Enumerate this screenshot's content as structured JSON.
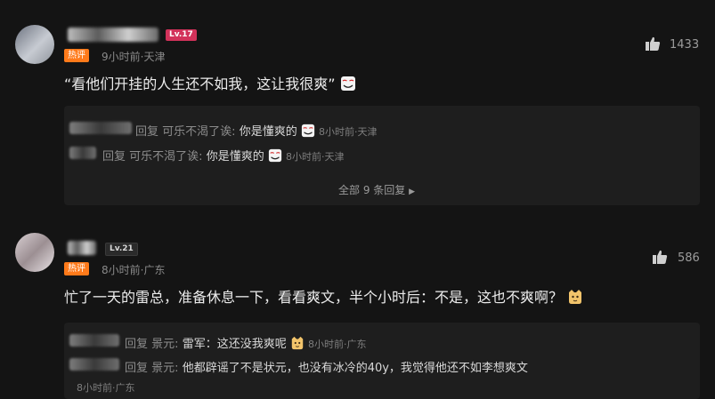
{
  "comments": [
    {
      "level": "Lv.17",
      "badge": "热评",
      "meta": "9小时前·天津",
      "text": "“看他们开挂的人生还不如我，这让我很爽”",
      "likes": "1433",
      "replies": [
        {
          "prefix": "回复",
          "target": "可乐不渴了诶:",
          "text": "你是懂爽的",
          "meta": "8小时前·天津"
        },
        {
          "prefix": "回复",
          "target": "可乐不渴了诶:",
          "text": "你是懂爽的",
          "meta": "8小时前·天津"
        }
      ],
      "more": "全部 9 条回复"
    },
    {
      "level": "Lv.21",
      "badge": "热评",
      "meta": "8小时前·广东",
      "text": "忙了一天的雷总，准备休息一下，看看爽文，半个小时后：不是，这也不爽啊？",
      "likes": "586",
      "replies": [
        {
          "prefix": "回复",
          "target": "景元:",
          "text": "雷军：这还没我爽呢",
          "meta": "8小时前·广东"
        },
        {
          "prefix": "回复",
          "target": "景元:",
          "text": "他都辟谣了不是状元，也没有冰冷的40y，我觉得他还不如李想爽文",
          "meta": "8小时前·广东"
        }
      ]
    }
  ],
  "icons": {
    "like": "thumbs-up-icon",
    "smirk": "smirk-emoji-icon",
    "cat": "cat-face-emoji-icon",
    "more": "chevron-right-icon"
  }
}
